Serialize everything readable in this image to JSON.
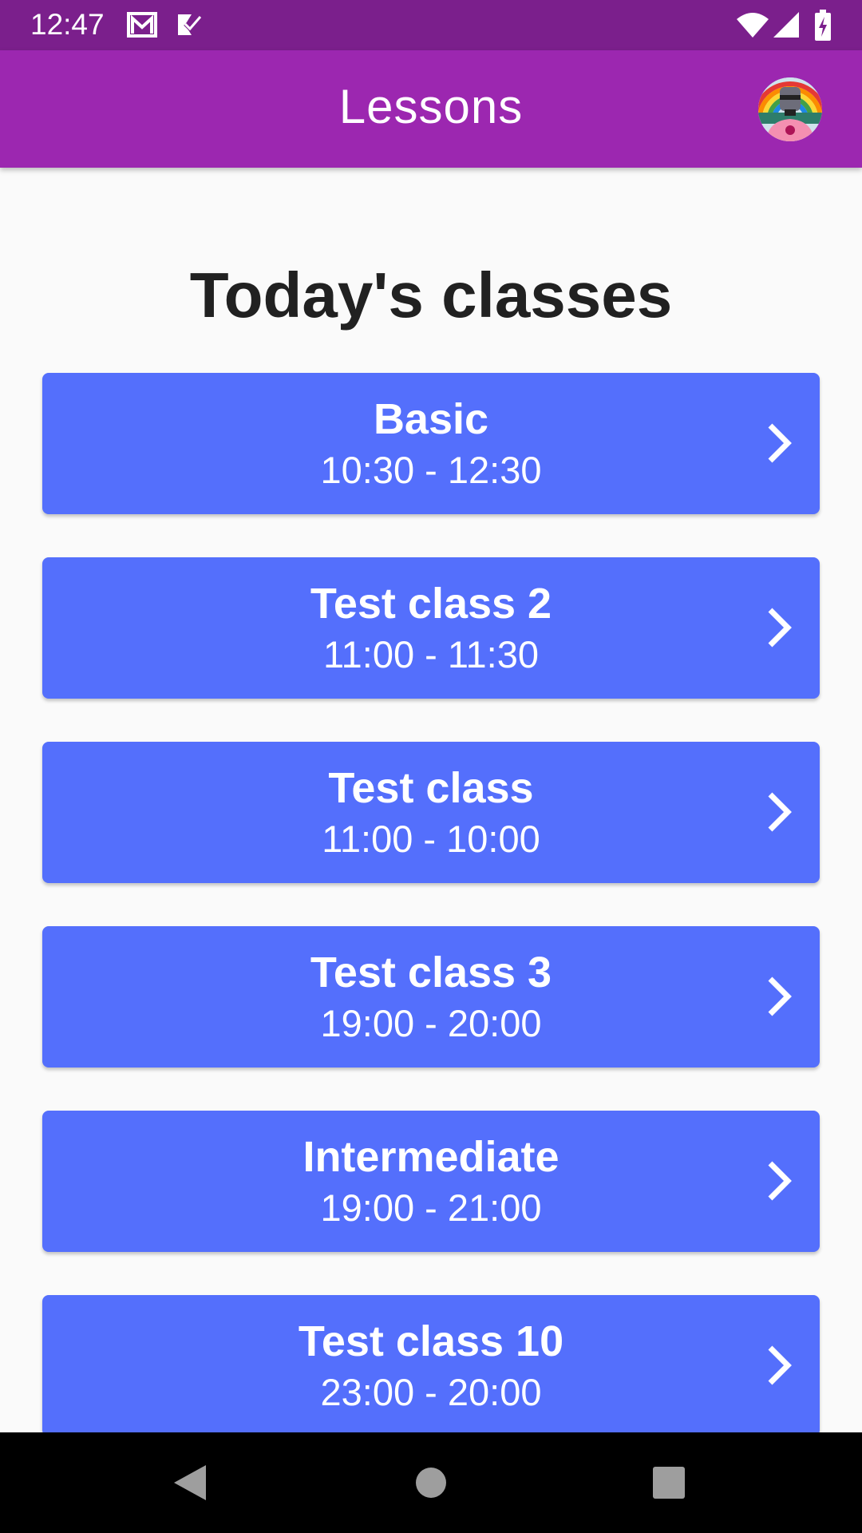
{
  "status_bar": {
    "time": "12:47",
    "notification_icons": [
      "gmail-icon",
      "task-check-icon"
    ],
    "system_icons": [
      "wifi-icon",
      "signal-icon",
      "battery-charging-icon"
    ]
  },
  "app_bar": {
    "title": "Lessons",
    "avatar_icon": "profile-avatar"
  },
  "main": {
    "heading": "Today's classes",
    "classes": [
      {
        "name": "Basic",
        "time": "10:30 - 12:30"
      },
      {
        "name": "Test class 2",
        "time": "11:00 - 11:30"
      },
      {
        "name": "Test class",
        "time": "11:00 - 10:00"
      },
      {
        "name": "Test class 3",
        "time": "19:00 - 20:00"
      },
      {
        "name": "Intermediate",
        "time": "19:00 - 21:00"
      },
      {
        "name": "Test class 10",
        "time": "23:00 - 20:00"
      }
    ],
    "card_icon": "chevron-right-icon"
  },
  "nav_bar": {
    "buttons": [
      "back-icon",
      "home-icon",
      "recents-icon"
    ]
  },
  "colors": {
    "status_bar": "#7b1f8c",
    "app_bar": "#9c27b0",
    "card": "#546ffc",
    "background": "#fafafa",
    "heading_text": "#212121"
  }
}
